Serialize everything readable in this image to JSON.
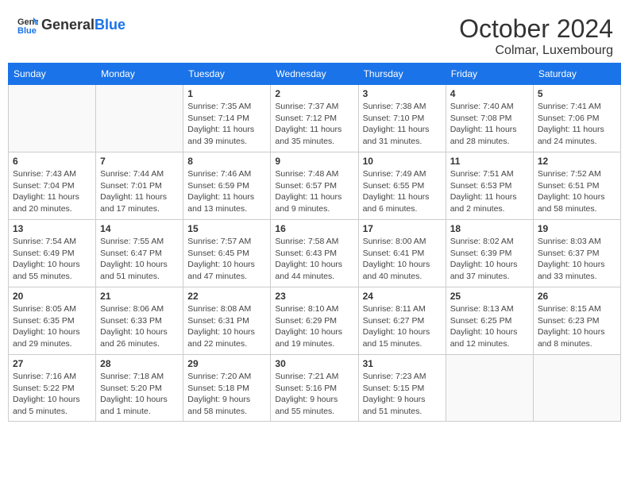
{
  "header": {
    "logo": {
      "general": "General",
      "blue": "Blue"
    },
    "title": "October 2024",
    "location": "Colmar, Luxembourg"
  },
  "days_of_week": [
    "Sunday",
    "Monday",
    "Tuesday",
    "Wednesday",
    "Thursday",
    "Friday",
    "Saturday"
  ],
  "weeks": [
    [
      {
        "day": "",
        "info": ""
      },
      {
        "day": "",
        "info": ""
      },
      {
        "day": "1",
        "info": "Sunrise: 7:35 AM\nSunset: 7:14 PM\nDaylight: 11 hours and 39 minutes."
      },
      {
        "day": "2",
        "info": "Sunrise: 7:37 AM\nSunset: 7:12 PM\nDaylight: 11 hours and 35 minutes."
      },
      {
        "day": "3",
        "info": "Sunrise: 7:38 AM\nSunset: 7:10 PM\nDaylight: 11 hours and 31 minutes."
      },
      {
        "day": "4",
        "info": "Sunrise: 7:40 AM\nSunset: 7:08 PM\nDaylight: 11 hours and 28 minutes."
      },
      {
        "day": "5",
        "info": "Sunrise: 7:41 AM\nSunset: 7:06 PM\nDaylight: 11 hours and 24 minutes."
      }
    ],
    [
      {
        "day": "6",
        "info": "Sunrise: 7:43 AM\nSunset: 7:04 PM\nDaylight: 11 hours and 20 minutes."
      },
      {
        "day": "7",
        "info": "Sunrise: 7:44 AM\nSunset: 7:01 PM\nDaylight: 11 hours and 17 minutes."
      },
      {
        "day": "8",
        "info": "Sunrise: 7:46 AM\nSunset: 6:59 PM\nDaylight: 11 hours and 13 minutes."
      },
      {
        "day": "9",
        "info": "Sunrise: 7:48 AM\nSunset: 6:57 PM\nDaylight: 11 hours and 9 minutes."
      },
      {
        "day": "10",
        "info": "Sunrise: 7:49 AM\nSunset: 6:55 PM\nDaylight: 11 hours and 6 minutes."
      },
      {
        "day": "11",
        "info": "Sunrise: 7:51 AM\nSunset: 6:53 PM\nDaylight: 11 hours and 2 minutes."
      },
      {
        "day": "12",
        "info": "Sunrise: 7:52 AM\nSunset: 6:51 PM\nDaylight: 10 hours and 58 minutes."
      }
    ],
    [
      {
        "day": "13",
        "info": "Sunrise: 7:54 AM\nSunset: 6:49 PM\nDaylight: 10 hours and 55 minutes."
      },
      {
        "day": "14",
        "info": "Sunrise: 7:55 AM\nSunset: 6:47 PM\nDaylight: 10 hours and 51 minutes."
      },
      {
        "day": "15",
        "info": "Sunrise: 7:57 AM\nSunset: 6:45 PM\nDaylight: 10 hours and 47 minutes."
      },
      {
        "day": "16",
        "info": "Sunrise: 7:58 AM\nSunset: 6:43 PM\nDaylight: 10 hours and 44 minutes."
      },
      {
        "day": "17",
        "info": "Sunrise: 8:00 AM\nSunset: 6:41 PM\nDaylight: 10 hours and 40 minutes."
      },
      {
        "day": "18",
        "info": "Sunrise: 8:02 AM\nSunset: 6:39 PM\nDaylight: 10 hours and 37 minutes."
      },
      {
        "day": "19",
        "info": "Sunrise: 8:03 AM\nSunset: 6:37 PM\nDaylight: 10 hours and 33 minutes."
      }
    ],
    [
      {
        "day": "20",
        "info": "Sunrise: 8:05 AM\nSunset: 6:35 PM\nDaylight: 10 hours and 29 minutes."
      },
      {
        "day": "21",
        "info": "Sunrise: 8:06 AM\nSunset: 6:33 PM\nDaylight: 10 hours and 26 minutes."
      },
      {
        "day": "22",
        "info": "Sunrise: 8:08 AM\nSunset: 6:31 PM\nDaylight: 10 hours and 22 minutes."
      },
      {
        "day": "23",
        "info": "Sunrise: 8:10 AM\nSunset: 6:29 PM\nDaylight: 10 hours and 19 minutes."
      },
      {
        "day": "24",
        "info": "Sunrise: 8:11 AM\nSunset: 6:27 PM\nDaylight: 10 hours and 15 minutes."
      },
      {
        "day": "25",
        "info": "Sunrise: 8:13 AM\nSunset: 6:25 PM\nDaylight: 10 hours and 12 minutes."
      },
      {
        "day": "26",
        "info": "Sunrise: 8:15 AM\nSunset: 6:23 PM\nDaylight: 10 hours and 8 minutes."
      }
    ],
    [
      {
        "day": "27",
        "info": "Sunrise: 7:16 AM\nSunset: 5:22 PM\nDaylight: 10 hours and 5 minutes."
      },
      {
        "day": "28",
        "info": "Sunrise: 7:18 AM\nSunset: 5:20 PM\nDaylight: 10 hours and 1 minute."
      },
      {
        "day": "29",
        "info": "Sunrise: 7:20 AM\nSunset: 5:18 PM\nDaylight: 9 hours and 58 minutes."
      },
      {
        "day": "30",
        "info": "Sunrise: 7:21 AM\nSunset: 5:16 PM\nDaylight: 9 hours and 55 minutes."
      },
      {
        "day": "31",
        "info": "Sunrise: 7:23 AM\nSunset: 5:15 PM\nDaylight: 9 hours and 51 minutes."
      },
      {
        "day": "",
        "info": ""
      },
      {
        "day": "",
        "info": ""
      }
    ]
  ]
}
